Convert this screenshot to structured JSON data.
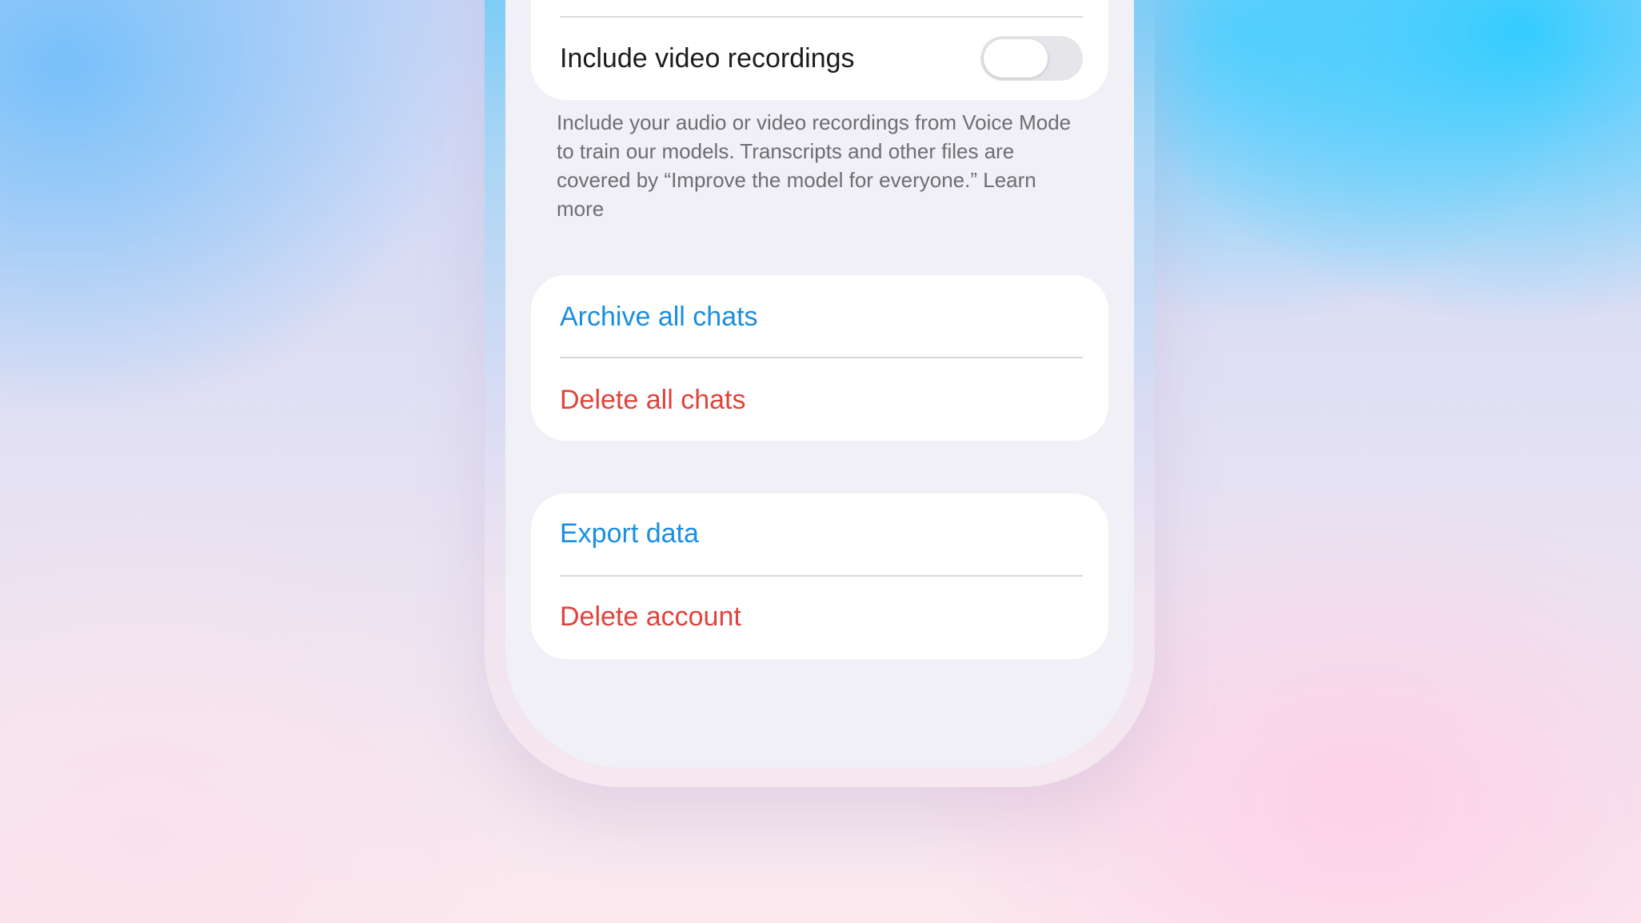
{
  "settings": {
    "video_toggle": {
      "label": "Include video recordings",
      "enabled": false
    },
    "footnote": {
      "text": "Include your audio or video recordings from Voice Mode to train our models. Transcripts and other files are covered by “Improve the model for everyone.”",
      "link": "Learn more"
    },
    "chats_group": {
      "archive_label": "Archive all chats",
      "delete_label": "Delete all chats"
    },
    "account_group": {
      "export_label": "Export data",
      "delete_account_label": "Delete account"
    }
  },
  "colors": {
    "accent_blue": "#1a8ee0",
    "destructive_red": "#e0433b",
    "toggle_off": "#e6e6ea",
    "screen_background": "#f1f0f6"
  }
}
